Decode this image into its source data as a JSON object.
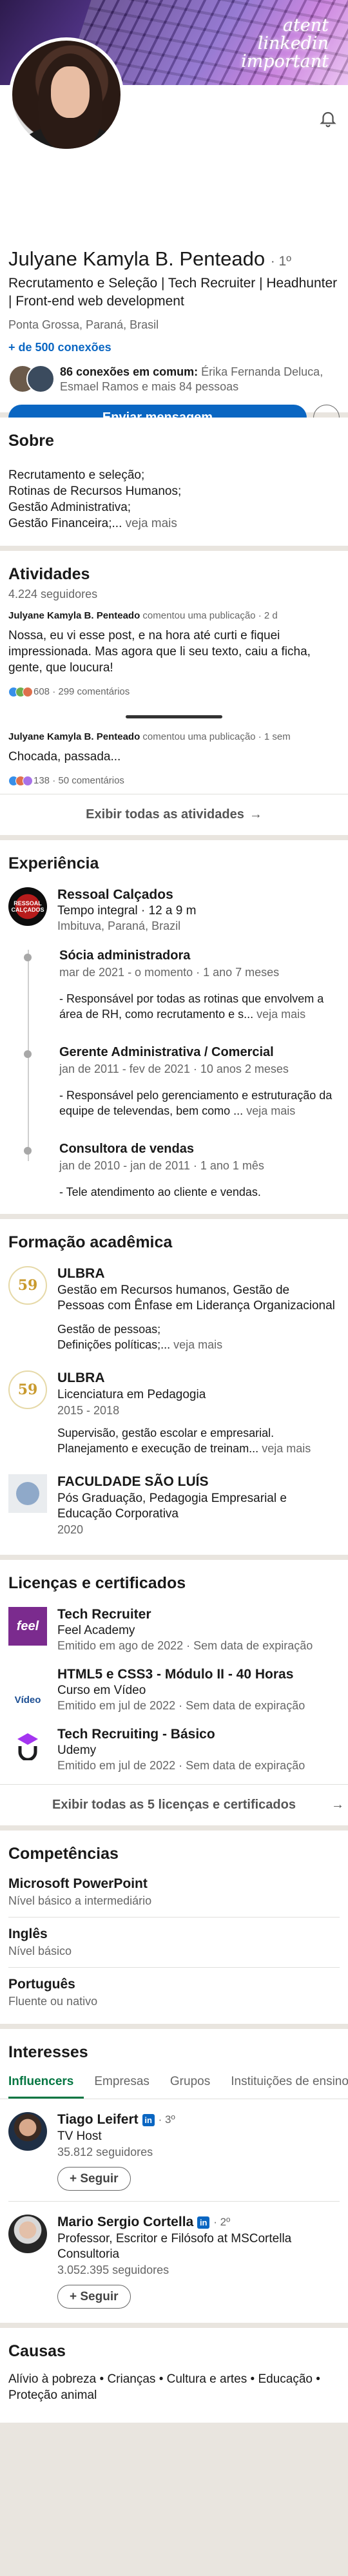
{
  "profile": {
    "banner_text": "atentlinkedinimportant",
    "name": "Julyane Kamyla B. Penteado",
    "degree": "· 1º",
    "headline": "Recrutamento e Seleção | Tech Recruiter | Headhunter | Front-end web development",
    "location": "Ponta Grossa, Paraná, Brasil",
    "connections": "+ de 500 conexões",
    "mutual_bold": "86 conexões em comum:",
    "mutual_rest": " Érika Fernanda Deluca, Esmael Ramos e mais 84 pessoas",
    "message_button": "Enviar mensagem",
    "more_button": "···"
  },
  "about": {
    "title": "Sobre",
    "text": "Recrutamento e seleção;\nRotinas de Recursos Humanos;\nGestão Administrativa;\nGestão Financeira;...",
    "see_more": " veja mais"
  },
  "activity": {
    "title": "Atividades",
    "followers": "4.224 seguidores",
    "posts": [
      {
        "author": "Julyane Kamyla B. Penteado",
        "meta": " comentou uma publicação · 2 d",
        "body": "Nossa, eu vi esse post, e na hora até curti e fiquei impressionada. Mas agora que li seu texto, caiu a ficha, gente, que loucura!",
        "stats": "608 · 299 comentários"
      },
      {
        "author": "Julyane Kamyla B. Penteado",
        "meta": " comentou uma publicação · 1 sem",
        "body": "Chocada, passada...",
        "stats": "138 · 50 comentários"
      }
    ],
    "see_all": "Exibir todas as atividades",
    "arrow": "→"
  },
  "experience": {
    "title": "Experiência",
    "company": "Ressoal Calçados",
    "company_logo_text": "RESSOAL CALÇADOS",
    "type": "Tempo integral · 12 a 9 m",
    "location": "Imbituva, Paraná, Brazil",
    "roles": [
      {
        "title": "Sócia administradora",
        "dates": "mar de 2021 - o momento · 1 ano 7 meses",
        "desc": "- Responsável por todas as rotinas que envolvem a área de RH, como recrutamento e s...",
        "more": " veja mais"
      },
      {
        "title": "Gerente Administrativa / Comercial",
        "dates": "jan de 2011 - fev de 2021 · 10 anos 2 meses",
        "desc": "- Responsável pelo gerenciamento e estruturação da equipe de televendas, bem como ...",
        "more": " veja mais"
      },
      {
        "title": "Consultora de vendas",
        "dates": "jan de 2010 - jan de 2011 · 1 ano 1 mês",
        "desc": "- Tele atendimento ao cliente e vendas.",
        "more": ""
      }
    ]
  },
  "education": {
    "title": "Formação acadêmica",
    "items": [
      {
        "logo": "59",
        "school": "ULBRA",
        "degree": "Gestão em Recursos humanos, Gestão de Pessoas com Ênfase em Liderança Organizacional",
        "years": "",
        "extra": "Gestão de pessoas;\nDefinições políticas;...",
        "more": " veja mais"
      },
      {
        "logo": "59",
        "school": "ULBRA",
        "degree": "Licenciatura em Pedagogia",
        "years": "2015 - 2018",
        "extra": "Supervisão, gestão escolar e empresarial.\nPlanejamento e execução de treinam...",
        "more": " veja mais"
      },
      {
        "logo": "",
        "school": "FACULDADE SÃO LUÍS",
        "degree": "Pós Graduação, Pedagogia Empresarial e Educação Corporativa",
        "years": "2020",
        "extra": "",
        "more": ""
      }
    ]
  },
  "licenses": {
    "title": "Licenças e certificados",
    "items": [
      {
        "logo": "feel",
        "name": "Tech Recruiter",
        "issuer": "Feel Academy",
        "meta": "Emitido em ago de 2022 · Sem data de expiração"
      },
      {
        "logo": "Vídeo",
        "name": "HTML5 e CSS3 - Módulo II - 40 Horas",
        "issuer": "Curso em Vídeo",
        "meta": "Emitido em jul de 2022 · Sem data de expiração"
      },
      {
        "logo": "udemy",
        "name": "Tech Recruiting - Básico",
        "issuer": "Udemy",
        "meta": "Emitido em jul de 2022 · Sem data de expiração"
      }
    ],
    "see_all": "Exibir todas as 5 licenças e certificados",
    "arrow": "→"
  },
  "skills": {
    "title": "Competências",
    "items": [
      {
        "name": "Microsoft PowerPoint",
        "level": "Nível básico a intermediário"
      },
      {
        "name": "Inglês",
        "level": "Nível básico"
      },
      {
        "name": "Português",
        "level": "Fluente ou nativo"
      }
    ]
  },
  "interests": {
    "title": "Interesses",
    "tabs": [
      "Influencers",
      "Empresas",
      "Grupos",
      "Instituições de ensino"
    ],
    "people": [
      {
        "name": "Tiago Leifert",
        "badge": "in",
        "degree": "· 3º",
        "headline": "TV Host",
        "followers": "35.812 seguidores",
        "follow": "+ Seguir"
      },
      {
        "name": "Mario Sergio Cortella",
        "badge": "in",
        "degree": "· 2º",
        "headline": "Professor, Escritor e Filósofo at MSCortella Consultoria",
        "followers": "3.052.395 seguidores",
        "follow": "+ Seguir"
      }
    ]
  },
  "causes": {
    "title": "Causas",
    "text": "Alívio à pobreza • Crianças • Cultura e artes • Educação • Proteção animal"
  }
}
